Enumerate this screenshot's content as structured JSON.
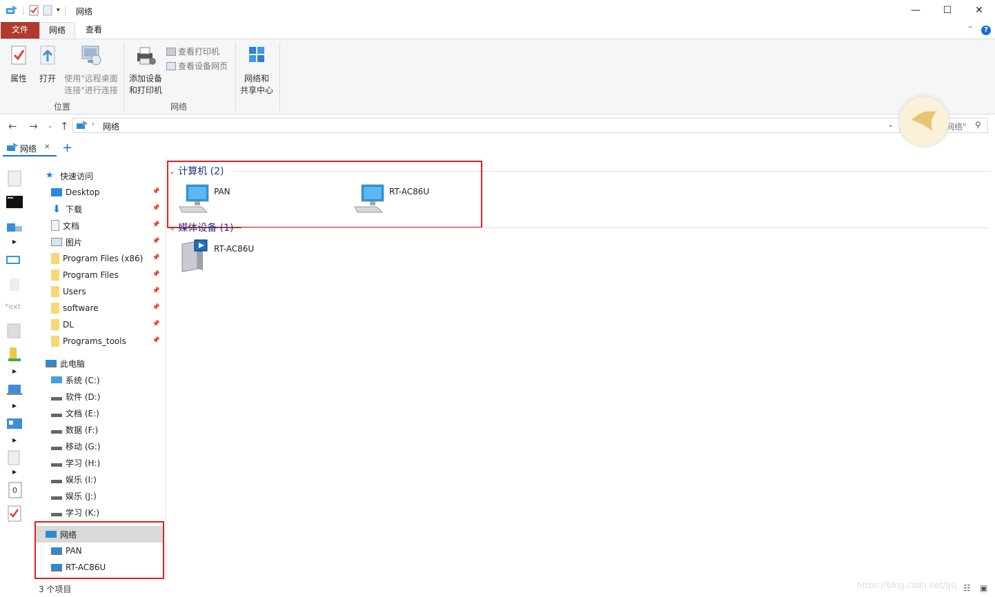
{
  "window": {
    "title": "网络",
    "minimize": "—",
    "maximize": "☐",
    "close": "✕"
  },
  "ribbon_tabs": {
    "file": "文件",
    "network": "网络",
    "view": "查看",
    "collapse": "^",
    "help": "?"
  },
  "ribbon": {
    "properties": "属性",
    "open": "打开",
    "remote_line1": "使用\"远程桌面",
    "remote_line2": "连接\"进行连接",
    "add_device_line1": "添加设备",
    "add_device_line2": "和打印机",
    "view_printers": "查看打印机",
    "view_device_page": "查看设备网页",
    "network_center_line1": "网络和",
    "network_center_line2": "共享中心",
    "group_location": "位置",
    "group_network": "网络"
  },
  "address": {
    "path": "网络",
    "search_placeholder": "网络\""
  },
  "folder_tab": {
    "label": "网络",
    "close": "✕",
    "add": "+"
  },
  "nav": {
    "quick_access": "快速访问",
    "quick_items": [
      "Desktop",
      "下载",
      "文档",
      "图片",
      "Program Files (x86)",
      "Program Files",
      "Users",
      "software",
      "DL",
      "Programs_tools"
    ],
    "this_pc": "此电脑",
    "drives": [
      "系统 (C:)",
      "软件 (D:)",
      "文档 (E:)",
      "数据 (F:)",
      "移动 (G:)",
      "学习 (H:)",
      "娱乐 (I:)",
      "娱乐 (J:)",
      "学习 (K:)"
    ],
    "network": "网络",
    "network_items": [
      "PAN",
      "RT-AC86U"
    ]
  },
  "content": {
    "computers_header": "计算机 (2)",
    "computers": [
      "PAN",
      "RT-AC86U"
    ],
    "media_header": "媒体设备 (1)",
    "media": [
      "RT-AC86U"
    ]
  },
  "status": {
    "count": "3 个项目"
  },
  "watermark": "https://blog.csdn.net/gsj",
  "colors": {
    "file_tab": "#b03a2e",
    "accent": "#1e3287",
    "highlight": "#e02020",
    "selected": "#d9d9d9"
  }
}
